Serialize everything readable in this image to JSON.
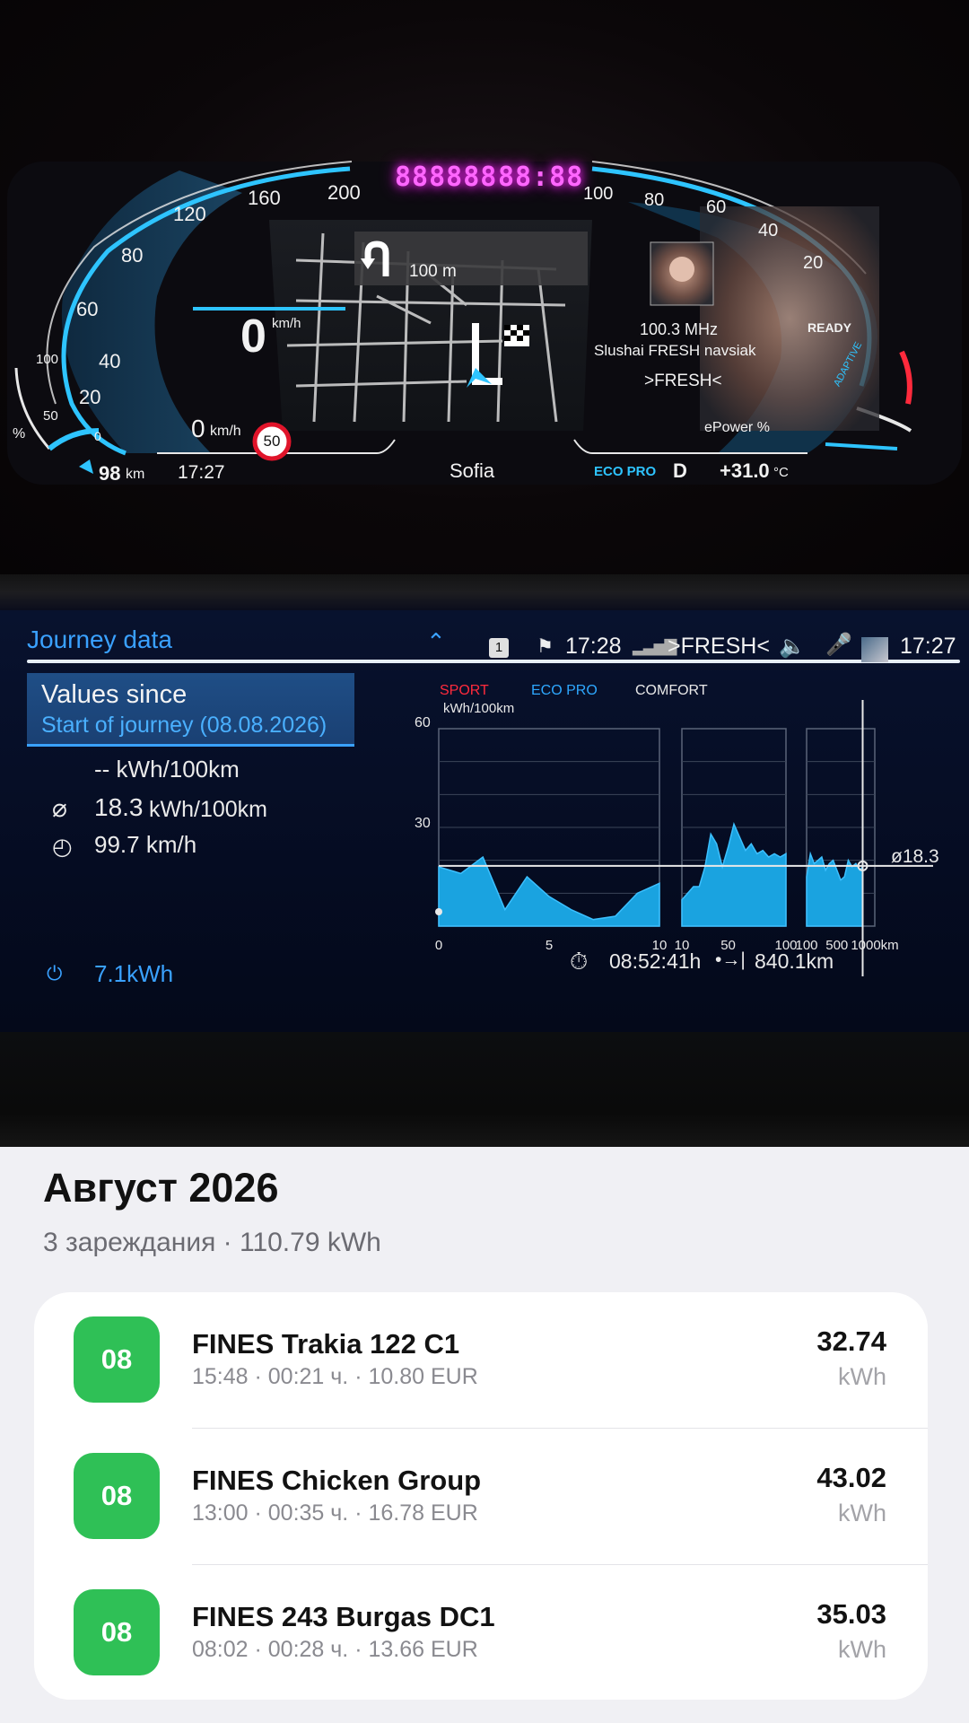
{
  "cluster": {
    "ghost_left": "888888",
    "ghost_right": "88:88",
    "speed_ticks": [
      "20",
      "40",
      "60",
      "80",
      "120",
      "160",
      "200"
    ],
    "speed_value": "0",
    "speed_unit_top": "km/h",
    "speed_unit_bottom": "km/h",
    "speed_zero": "0",
    "speed_limit": "50",
    "nav_distance": "100 m",
    "charge_scale": [
      "50",
      "100"
    ],
    "charge_zero": "0",
    "charge_pct": "%",
    "range": "98",
    "range_unit": "km",
    "clock": "17:27",
    "city": "Sofia",
    "drive_mode": "ECO PRO",
    "gear": "D",
    "temperature": "+31.0",
    "temperature_unit": "°C",
    "radio_freq": "100.3 MHz",
    "radio_text": "Slushai FRESH navsiak",
    "radio_station": ">FRESH<",
    "power_ticks": [
      "100",
      "80",
      "60",
      "40",
      "20"
    ],
    "ready": "READY",
    "adaptive": "ADAPTIVE",
    "epower": "ePower %"
  },
  "journey": {
    "title": "Journey data",
    "status_badge": "1",
    "status_time": "17:28",
    "status_station": ">FRESH<",
    "status_clock": "17:27",
    "values_since": "Values since",
    "start_of_journey": "Start of journey (08.08.2026)",
    "current_consumption": "-- kWh/100km",
    "avg_consumption_value": "18.3",
    "avg_consumption_unit": "kWh/100km",
    "avg_speed": "99.7 km/h",
    "battery_energy": "7.1kWh",
    "duration": "08:52:41h",
    "distance": "840.1km"
  },
  "chart_data": {
    "type": "area",
    "legend": [
      "SPORT",
      "ECO PRO",
      "COMFORT"
    ],
    "legend_colors": [
      "#ff2a3c",
      "#2ea8ff",
      "#e8e8e8"
    ],
    "ylabel": "kWh/100km",
    "ylim": [
      0,
      60
    ],
    "yticks": [
      "60",
      "30"
    ],
    "average": 18.3,
    "average_label": "ø18.3",
    "xunit": "km",
    "panels": [
      {
        "xlim": [
          0,
          10
        ],
        "xticks": [
          "0",
          "5",
          "10"
        ],
        "x": [
          0,
          1,
          2,
          3,
          4,
          5,
          6,
          7,
          8,
          9,
          10
        ],
        "values": [
          18,
          16,
          21,
          5,
          15,
          9,
          5,
          2,
          3,
          10,
          13
        ]
      },
      {
        "xlim": [
          10,
          100
        ],
        "xticks": [
          "10",
          "50",
          "100"
        ],
        "x": [
          10,
          15,
          20,
          25,
          30,
          35,
          40,
          45,
          50,
          55,
          60,
          65,
          70,
          75,
          80,
          85,
          90,
          95,
          100
        ],
        "values": [
          8,
          10,
          12,
          12,
          18,
          28,
          25,
          18,
          24,
          31,
          27,
          23,
          25,
          22,
          23,
          21,
          22,
          21,
          22
        ]
      },
      {
        "xlim": [
          100,
          1000
        ],
        "xticks": [
          "100",
          "500",
          "1000"
        ],
        "x": [
          100,
          150,
          200,
          250,
          300,
          350,
          400,
          450,
          500,
          550,
          600,
          650,
          700,
          750,
          800,
          840
        ],
        "values": [
          15,
          22,
          19,
          20,
          21,
          17,
          19,
          20,
          17,
          14,
          15,
          20,
          18,
          19,
          17,
          18
        ]
      }
    ],
    "position_km": 840
  },
  "app": {
    "month": "Август 2026",
    "summary": "3 зареждания · 110.79 kWh",
    "sessions": [
      {
        "day": "08",
        "name": "FINES Trakia 122 C1",
        "meta": "15:48 · 00:21 ч. · 10.80 EUR",
        "energy": "32.74",
        "unit": "kWh"
      },
      {
        "day": "08",
        "name": "FINES Chicken Group",
        "meta": "13:00 · 00:35 ч. · 16.78 EUR",
        "energy": "43.02",
        "unit": "kWh"
      },
      {
        "day": "08",
        "name": "FINES 243 Burgas DC1",
        "meta": "08:02 · 00:28 ч. · 13.66 EUR",
        "energy": "35.03",
        "unit": "kWh"
      }
    ],
    "accent": "#2fc056"
  }
}
